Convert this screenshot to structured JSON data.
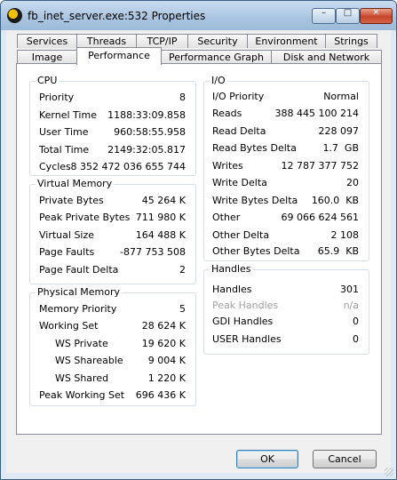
{
  "window": {
    "title": "fb_inet_server.exe:532 Properties"
  },
  "titlebar_buttons": {
    "minimize": "–",
    "maximize": "□",
    "close": "✕"
  },
  "tabs_row1": [
    "Services",
    "Threads",
    "TCP/IP",
    "Security",
    "Environment",
    "Strings"
  ],
  "tabs_row2": [
    "Image",
    "Performance",
    "Performance Graph",
    "Disk and Network"
  ],
  "active_tab": "Performance",
  "cpu": {
    "title": "CPU",
    "rows": [
      {
        "label": "Priority",
        "value": "8"
      },
      {
        "label": "Kernel Time",
        "value": "1188:33:09.858"
      },
      {
        "label": "User Time",
        "value": "960:58:55.958"
      },
      {
        "label": "Total Time",
        "value": "2149:32:05.817"
      },
      {
        "label": "Cycles",
        "value": ".8 352 472 036 655 744"
      }
    ]
  },
  "virtual_memory": {
    "title": "Virtual Memory",
    "rows": [
      {
        "label": "Private Bytes",
        "value": "45 264 K"
      },
      {
        "label": "Peak Private Bytes",
        "value": "711 980 K"
      },
      {
        "label": "Virtual Size",
        "value": "164 488 K"
      },
      {
        "label": "Page Faults",
        "value": "-877 753 508"
      },
      {
        "label": "Page Fault Delta",
        "value": "2"
      }
    ]
  },
  "physical_memory": {
    "title": "Physical Memory",
    "rows": [
      {
        "label": "Memory Priority",
        "value": "5"
      },
      {
        "label": "Working Set",
        "value": "28 624 K"
      },
      {
        "label": "WS Private",
        "value": "19 620 K"
      },
      {
        "label": "WS Shareable",
        "value": "9 004 K"
      },
      {
        "label": "WS Shared",
        "value": "1 220 K"
      },
      {
        "label": "Peak Working Set",
        "value": "696 436 K"
      }
    ]
  },
  "io": {
    "title": "I/O",
    "rows": [
      {
        "label": "I/O Priority",
        "value": "Normal"
      },
      {
        "label": "Reads",
        "value": "388 445 100 214"
      },
      {
        "label": "Read Delta",
        "value": "228 097"
      },
      {
        "label": "Read Bytes Delta",
        "value": "1.7  GB"
      },
      {
        "label": "Writes",
        "value": "12 787 377 752"
      },
      {
        "label": "Write Delta",
        "value": "20"
      },
      {
        "label": "Write Bytes Delta",
        "value": "160.0  KB"
      },
      {
        "label": "Other",
        "value": "69 066 624 561"
      },
      {
        "label": "Other Delta",
        "value": "2 108"
      },
      {
        "label": "Other Bytes Delta",
        "value": "65.9  KB"
      }
    ]
  },
  "handles": {
    "title": "Handles",
    "rows": [
      {
        "label": "Handles",
        "value": "301"
      },
      {
        "label": "Peak Handles",
        "value": "n/a"
      },
      {
        "label": "GDI Handles",
        "value": "0"
      },
      {
        "label": "USER Handles",
        "value": "0"
      }
    ]
  },
  "buttons": {
    "ok": "OK",
    "cancel": "Cancel"
  }
}
